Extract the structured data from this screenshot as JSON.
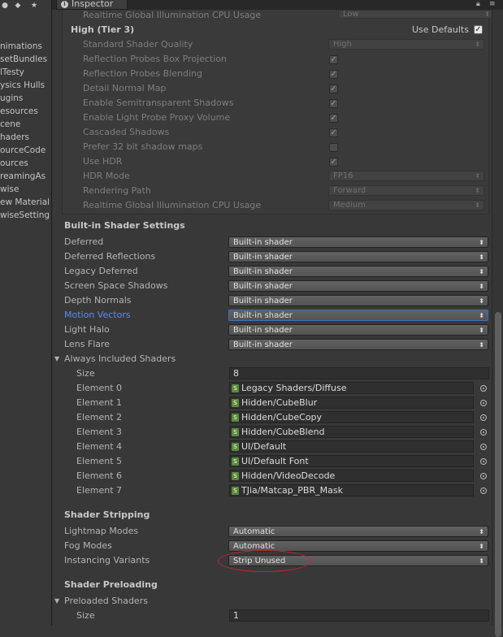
{
  "project": {
    "toolbar": {
      "create_icon": "create-icon",
      "tag_icon": "tag-icon",
      "star_icon": "star-icon"
    },
    "items": [
      "nimations",
      "setBundles",
      "lTesty",
      "ysics Hulls",
      "ugins",
      "esources",
      "cene",
      "haders",
      "ourceCode",
      "ources",
      "reamingAs",
      "wise",
      "ew Material",
      "wiseSetting"
    ]
  },
  "inspector": {
    "tab_label": "Inspector",
    "lock_icon": "lock-icon",
    "menu_icon": "menu-icon"
  },
  "tier2_tail": {
    "gi_label": "Realtime Global Illumination CPU Usage",
    "gi_value": "Low"
  },
  "tier3": {
    "title": "High (Tier 3)",
    "use_defaults_label": "Use Defaults",
    "use_defaults_checked": true,
    "settings": [
      {
        "label": "Standard Shader Quality",
        "type": "dropdown",
        "value": "High"
      },
      {
        "label": "Reflection Probes Box Projection",
        "type": "check",
        "checked": true
      },
      {
        "label": "Reflection Probes Blending",
        "type": "check",
        "checked": true
      },
      {
        "label": "Detail Normal Map",
        "type": "check",
        "checked": true
      },
      {
        "label": "Enable Semitransparent Shadows",
        "type": "check",
        "checked": true
      },
      {
        "label": "Enable Light Probe Proxy Volume",
        "type": "check",
        "checked": true
      },
      {
        "label": "Cascaded Shadows",
        "type": "check",
        "checked": true
      },
      {
        "label": "Prefer 32 bit shadow maps",
        "type": "check",
        "checked": false
      },
      {
        "label": "Use HDR",
        "type": "check",
        "checked": true
      },
      {
        "label": "HDR Mode",
        "type": "dropdown",
        "value": "FP16"
      },
      {
        "label": "Rendering Path",
        "type": "dropdown",
        "value": "Forward"
      },
      {
        "label": "Realtime Global Illumination CPU Usage",
        "type": "dropdown",
        "value": "Medium"
      }
    ]
  },
  "builtin": {
    "header": "Built-in Shader Settings",
    "rows": [
      {
        "label": "Deferred",
        "value": "Built-in shader"
      },
      {
        "label": "Deferred Reflections",
        "value": "Built-in shader"
      },
      {
        "label": "Legacy Deferred",
        "value": "Built-in shader"
      },
      {
        "label": "Screen Space Shadows",
        "value": "Built-in shader"
      },
      {
        "label": "Depth Normals",
        "value": "Built-in shader"
      },
      {
        "label": "Motion Vectors",
        "value": "Built-in shader",
        "focused": true
      },
      {
        "label": "Light Halo",
        "value": "Built-in shader"
      },
      {
        "label": "Lens Flare",
        "value": "Built-in shader"
      }
    ]
  },
  "always_included": {
    "label": "Always Included Shaders",
    "size_label": "Size",
    "size_value": "8",
    "elements": [
      {
        "label": "Element 0",
        "value": "Legacy Shaders/Diffuse"
      },
      {
        "label": "Element 1",
        "value": "Hidden/CubeBlur"
      },
      {
        "label": "Element 2",
        "value": "Hidden/CubeCopy"
      },
      {
        "label": "Element 3",
        "value": "Hidden/CubeBlend"
      },
      {
        "label": "Element 4",
        "value": "UI/Default"
      },
      {
        "label": "Element 5",
        "value": "UI/Default Font"
      },
      {
        "label": "Element 6",
        "value": "Hidden/VideoDecode"
      },
      {
        "label": "Element 7",
        "value": "TJia/Matcap_PBR_Mask"
      }
    ]
  },
  "stripping": {
    "header": "Shader Stripping",
    "rows": [
      {
        "label": "Lightmap Modes",
        "value": "Automatic"
      },
      {
        "label": "Fog Modes",
        "value": "Automatic"
      },
      {
        "label": "Instancing Variants",
        "value": "Strip Unused"
      }
    ]
  },
  "preloading": {
    "header": "Shader Preloading",
    "list_label": "Preloaded Shaders",
    "size_label": "Size",
    "size_value": "1"
  },
  "colors": {
    "highlight_label": "#5a8cf0",
    "annotation": "#c8222c",
    "focus_border": "#3a72c8"
  }
}
